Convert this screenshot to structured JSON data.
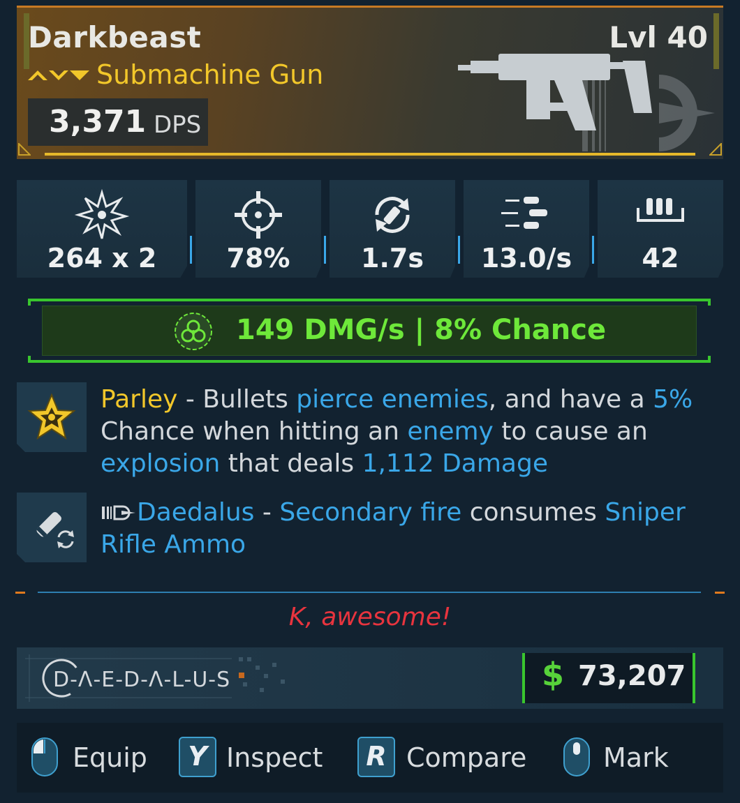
{
  "header": {
    "weapon_name": "Darkbeast",
    "level": "Lvl 40",
    "weapon_type": "Submachine Gun",
    "dps_value": "3,371",
    "dps_unit": "DPS",
    "rarity_icon": "rarity-chevrons-icon",
    "rarity_color": "#f2c72a"
  },
  "stats": [
    {
      "icon": "damage-burst-icon",
      "value": "264 x 2"
    },
    {
      "icon": "crosshair-accuracy-icon",
      "value": "78%"
    },
    {
      "icon": "reload-icon",
      "value": "1.7s"
    },
    {
      "icon": "fire-rate-icon",
      "value": "13.0/s"
    },
    {
      "icon": "magazine-ammo-icon",
      "value": "42"
    }
  ],
  "elemental": {
    "icon": "corrosive-biohazard-icon",
    "text": "149 DMG/s | 8% Chance",
    "color": "#6ee83a"
  },
  "perks": [
    {
      "icon": "parley-star-icon",
      "name": "Parley",
      "segments": [
        {
          "text": "Parley",
          "style": "yellow"
        },
        {
          "text": " - Bullets ",
          "style": "plain"
        },
        {
          "text": "pierce enemies",
          "style": "blue"
        },
        {
          "text": ", and have a ",
          "style": "plain"
        },
        {
          "text": "5%",
          "style": "blue"
        },
        {
          "text": " Chance when hitting an ",
          "style": "plain"
        },
        {
          "text": "enemy",
          "style": "blue"
        },
        {
          "text": " to cause an ",
          "style": "plain"
        },
        {
          "text": "explosion",
          "style": "blue"
        },
        {
          "text": " that deals ",
          "style": "plain"
        },
        {
          "text": "1,112 Damage",
          "style": "blue"
        }
      ]
    },
    {
      "icon": "ammo-swap-icon",
      "name": "Daedalus",
      "segments": [
        {
          "text": "Daedalus",
          "style": "blue"
        },
        {
          "text": " - ",
          "style": "plain"
        },
        {
          "text": "Secondary fire",
          "style": "blue"
        },
        {
          "text": " consumes ",
          "style": "plain"
        },
        {
          "text": "Sniper Rifle Ammo",
          "style": "blue"
        }
      ]
    }
  ],
  "flavor_text": "K, awesome!",
  "manufacturer": {
    "name": "D-Λ-E-D-Λ-L-U-S",
    "logo_icon": "daedalus-logo-icon"
  },
  "price": {
    "currency_symbol": "$",
    "value": "73,207"
  },
  "actions": [
    {
      "key_icon": "mouse-left-icon",
      "key": "",
      "label": "Equip"
    },
    {
      "key_icon": "keycap-y-icon",
      "key": "Y",
      "label": "Inspect"
    },
    {
      "key_icon": "keycap-r-icon",
      "key": "R",
      "label": "Compare"
    },
    {
      "key_icon": "mouse-middle-icon",
      "key": "",
      "label": "Mark"
    }
  ],
  "colors": {
    "header_gold": "#c77a24",
    "underline_yellow": "#e6b82a",
    "accent_blue": "#3aa7e8",
    "accent_green": "#39c62e",
    "flavor_red": "#e8343e"
  }
}
